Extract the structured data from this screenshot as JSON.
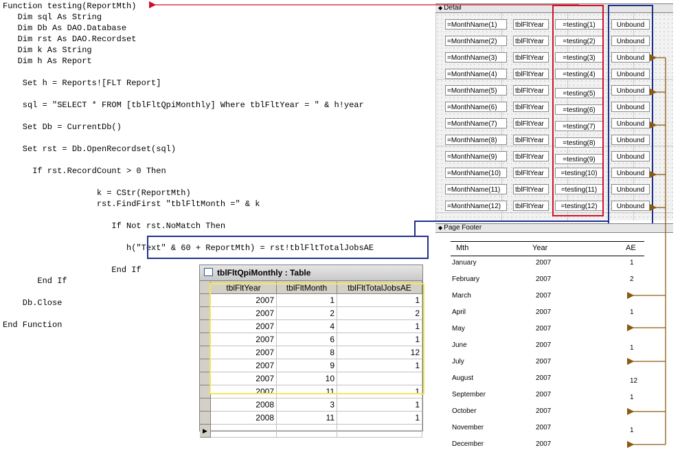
{
  "code": {
    "lines": [
      "Function testing(ReportMth)",
      "   Dim sql As String",
      "   Dim Db As DAO.Database",
      "   Dim rst As DAO.Recordset",
      "   Dim k As String",
      "   Dim h As Report",
      "    Set h = Reports![FLT Report]",
      "    sql = \"SELECT * FROM [tblFltQpiMonthly] Where tblFltYear = \" & h!year",
      "    Set Db = CurrentDb()",
      "    Set rst = Db.OpenRecordset(sql)",
      "      If rst.RecordCount > 0 Then",
      "                   k = CStr(ReportMth)",
      "                   rst.FindFirst \"tblFltMonth =\" & k",
      "                      If Not rst.NoMatch Then",
      "                         h(\"Text\" & 60 + ReportMth) = rst!tblFltTotalJobsAE",
      "                      End If",
      "       End If",
      "    Db.Close",
      "End Function"
    ]
  },
  "report": {
    "detail_label": "Detail",
    "footer_label": "Page Footer",
    "detail_rows": [
      {
        "month": "=MonthName(1)",
        "year": "tblFltYear",
        "testing": "=testing(1)",
        "unbound": "Unbound"
      },
      {
        "month": "=MonthName(2)",
        "year": "tblFltYear",
        "testing": "=testing(2)",
        "unbound": "Unbound"
      },
      {
        "month": "=MonthName(3)",
        "year": "tblFltYear",
        "testing": "=testing(3)",
        "unbound": "Unbound"
      },
      {
        "month": "=MonthName(4)",
        "year": "tblFltYear",
        "testing": "=testing(4)",
        "unbound": "Unbound"
      },
      {
        "month": "=MonthName(5)",
        "year": "tblFltYear",
        "testing": "=testing(5)",
        "unbound": "Unbound"
      },
      {
        "month": "=MonthName(6)",
        "year": "tblFltYear",
        "testing": "=testing(6)",
        "unbound": "Unbound"
      },
      {
        "month": "=MonthName(7)",
        "year": "tblFltYear",
        "testing": "=testing(7)",
        "unbound": "Unbound"
      },
      {
        "month": "=MonthName(8)",
        "year": "tblFltYear",
        "testing": "=testing(8)",
        "unbound": "Unbound"
      },
      {
        "month": "=MonthName(9)",
        "year": "tblFltYear",
        "testing": "=testing(9)",
        "unbound": "Unbound"
      },
      {
        "month": "=MonthName(10)",
        "year": "tblFltYear",
        "testing": "=testing(10)",
        "unbound": "Unbound"
      },
      {
        "month": "=MonthName(11)",
        "year": "tblFltYear",
        "testing": "=testing(11)",
        "unbound": "Unbound"
      },
      {
        "month": "=MonthName(12)",
        "year": "tblFltYear",
        "testing": "=testing(12)",
        "unbound": "Unbound"
      }
    ],
    "output": {
      "headers": {
        "mth": "Mth",
        "year": "Year",
        "ae": "AE"
      },
      "rows": [
        {
          "mth": "January",
          "year": "2007",
          "ae": "1"
        },
        {
          "mth": "February",
          "year": "2007",
          "ae": "2"
        },
        {
          "mth": "March",
          "year": "2007",
          "ae": ""
        },
        {
          "mth": "April",
          "year": "2007",
          "ae": "1"
        },
        {
          "mth": "May",
          "year": "2007",
          "ae": ""
        },
        {
          "mth": "June",
          "year": "2007",
          "ae": "1"
        },
        {
          "mth": "July",
          "year": "2007",
          "ae": ""
        },
        {
          "mth": "August",
          "year": "2007",
          "ae": "12"
        },
        {
          "mth": "September",
          "year": "2007",
          "ae": "1"
        },
        {
          "mth": "October",
          "year": "2007",
          "ae": ""
        },
        {
          "mth": "November",
          "year": "2007",
          "ae": "1"
        },
        {
          "mth": "December",
          "year": "2007",
          "ae": ""
        }
      ]
    }
  },
  "table": {
    "title": "tblFltQpiMonthly : Table",
    "columns": [
      "tblFltYear",
      "tblFltMonth",
      "tblFltTotalJobsAE"
    ],
    "rows": [
      [
        "2007",
        "1",
        "1"
      ],
      [
        "2007",
        "2",
        "2"
      ],
      [
        "2007",
        "4",
        "1"
      ],
      [
        "2007",
        "6",
        "1"
      ],
      [
        "2007",
        "8",
        "12"
      ],
      [
        "2007",
        "9",
        "1"
      ],
      [
        "2007",
        "10",
        ""
      ],
      [
        "2007",
        "11",
        "1"
      ],
      [
        "2008",
        "3",
        "1"
      ],
      [
        "2008",
        "11",
        "1"
      ]
    ]
  },
  "colors": {
    "red_highlight": "#d0102a",
    "blue_highlight": "#1f2f8a",
    "yellow_highlight": "#f2e85a",
    "brown_arrow": "#8a5a10"
  }
}
